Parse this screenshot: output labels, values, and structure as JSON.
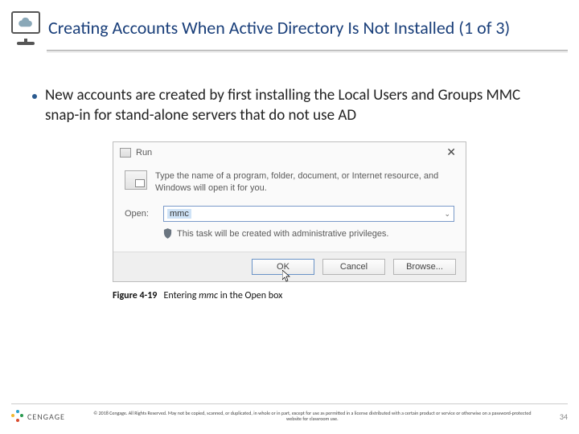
{
  "header": {
    "title": "Creating Accounts When Active Directory Is Not Installed (1 of 3)"
  },
  "bullet": {
    "text": "New accounts are created by first installing the Local Users and Groups MMC snap-in for stand-alone servers that do not use AD"
  },
  "run_dialog": {
    "title": "Run",
    "close": "✕",
    "description": "Type the name of a program, folder, document, or Internet resource, and Windows will open it for you.",
    "open_label": "Open:",
    "input_value": "mmc",
    "privilege_note": "This task will be created with administrative privileges.",
    "buttons": {
      "ok": "OK",
      "cancel": "Cancel",
      "browse": "Browse..."
    }
  },
  "figure": {
    "number": "Figure 4-19",
    "caption_prefix": "Entering ",
    "caption_code": "mmc",
    "caption_suffix": " in the Open box"
  },
  "footer": {
    "brand": "CENGAGE",
    "copyright": "© 2018 Cengage. All Rights Reserved. May not be copied, scanned, or duplicated, in whole or in part, except for use as permitted in a license distributed with a certain product or service or otherwise on a password-protected website for classroom use.",
    "page": "34"
  }
}
